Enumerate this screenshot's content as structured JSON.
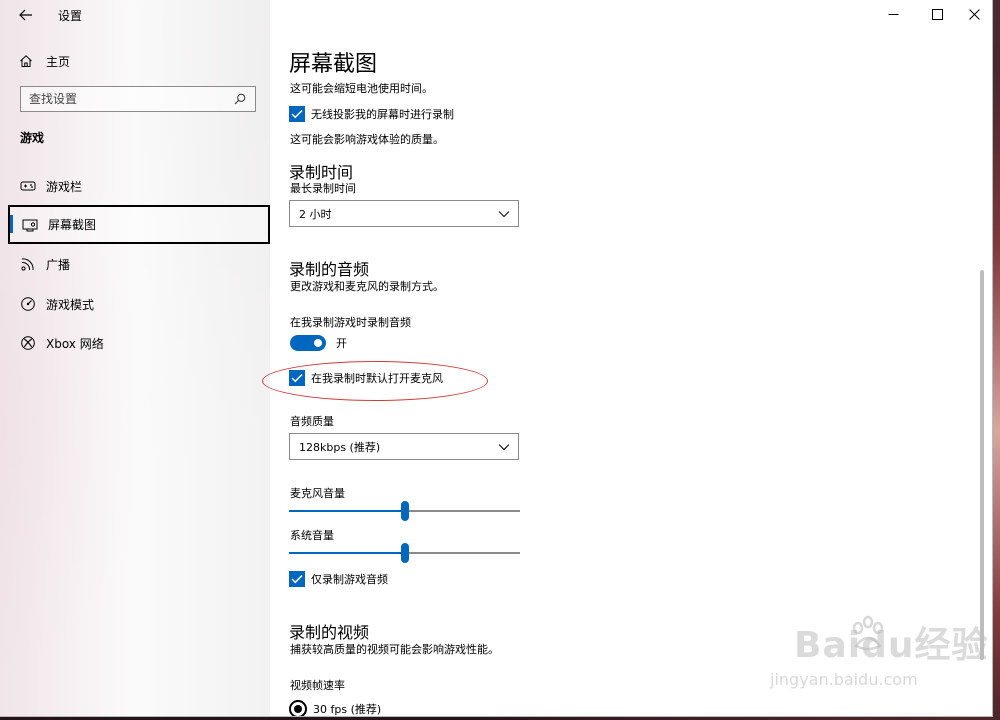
{
  "window": {
    "title": "设置",
    "controls": {
      "minimize": "—",
      "maximize": "☐",
      "close": "✕"
    }
  },
  "sidebar": {
    "home_label": "主页",
    "search_placeholder": "查找设置",
    "section_title": "游戏",
    "items": [
      {
        "label": "游戏栏",
        "icon": "game-bar-icon",
        "selected": false
      },
      {
        "label": "屏幕截图",
        "icon": "capture-icon",
        "selected": true
      },
      {
        "label": "广播",
        "icon": "broadcast-icon",
        "selected": false
      },
      {
        "label": "游戏模式",
        "icon": "game-mode-icon",
        "selected": false
      },
      {
        "label": "Xbox 网络",
        "icon": "xbox-icon",
        "selected": false
      }
    ]
  },
  "main": {
    "page_title": "屏幕截图",
    "battery_note": "这可能会缩短电池使用时间。",
    "wireless_checkbox": {
      "label": "无线投影我的屏幕时进行录制",
      "checked": true
    },
    "quality_note": "这可能会影响游戏体验的质量。",
    "record_time": {
      "heading": "录制时间",
      "label": "最长录制时间",
      "value": "2 小时"
    },
    "audio": {
      "heading": "录制的音频",
      "desc": "更改游戏和麦克风的录制方式。",
      "record_audio_label": "在我录制游戏时录制音频",
      "toggle_state": "开",
      "mic_checkbox": {
        "label": "在我录制时默认打开麦克风",
        "checked": true
      },
      "quality_label": "音频质量",
      "quality_value": "128kbps (推荐)",
      "mic_volume_label": "麦克风音量",
      "mic_volume": 0.5,
      "system_volume_label": "系统音量",
      "system_volume": 0.5,
      "game_only_checkbox": {
        "label": "仅录制游戏音频",
        "checked": true
      }
    },
    "video": {
      "heading": "录制的视频",
      "desc": "捕获较高质量的视频可能会影响游戏性能。",
      "fps_label": "视频帧速率",
      "fps_option": "30 fps (推荐)"
    }
  },
  "watermark": {
    "brand": "Baidu经验",
    "url": "jingyan.baidu.com"
  },
  "colors": {
    "accent": "#0067c0",
    "annotation": "#d33a3a"
  }
}
